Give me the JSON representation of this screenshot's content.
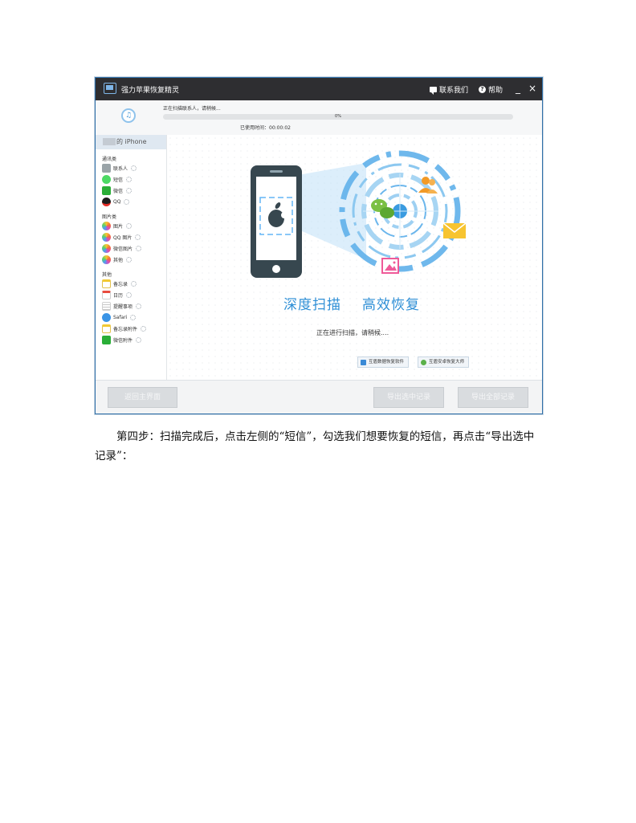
{
  "window": {
    "title": "强力苹果恢复精灵",
    "contact_label": "联系我们",
    "help_label": "帮助",
    "minimize_glyph": "_",
    "close_glyph": "×"
  },
  "progress": {
    "status": "正在扫描联系人，请稍候...",
    "percent_label": "0%",
    "percent_value": 0,
    "elapsed": "已使用时间：00:00:02"
  },
  "sidebar": {
    "device_label": "的 iPhone",
    "categories": [
      {
        "title": "通讯类",
        "items": [
          "联系人",
          "短信",
          "微信",
          "QQ"
        ]
      },
      {
        "title": "图片类",
        "items": [
          "图片",
          "QQ 图片",
          "微信图片",
          "其他"
        ]
      },
      {
        "title": "其他",
        "items": [
          "备忘录",
          "日历",
          "提醒事项",
          "Safari",
          "备忘录附件",
          "微信附件"
        ]
      }
    ]
  },
  "main": {
    "headline_left": "深度扫描",
    "headline_right": "高效恢复",
    "scanning_text": "正在进行扫描，请稍候....",
    "link_button_1": "互盾数据恢复软件",
    "link_button_2": "互盾安卓恢复大师"
  },
  "footer": {
    "back_button": "返回主界面",
    "export_selected_button": "导出选中记录",
    "export_all_button": "导出全部记录"
  },
  "document": {
    "paragraph": "第四步：扫描完成后，点击左侧的“短信”，勾选我们想要恢复的短信，再点击“导出选中记录”："
  },
  "colors": {
    "titlebar": "#2e2e31",
    "accent_blue": "#2f8fd6",
    "progress_fill": "#4fa3e3",
    "disabled_button": "#d9dcdf"
  }
}
